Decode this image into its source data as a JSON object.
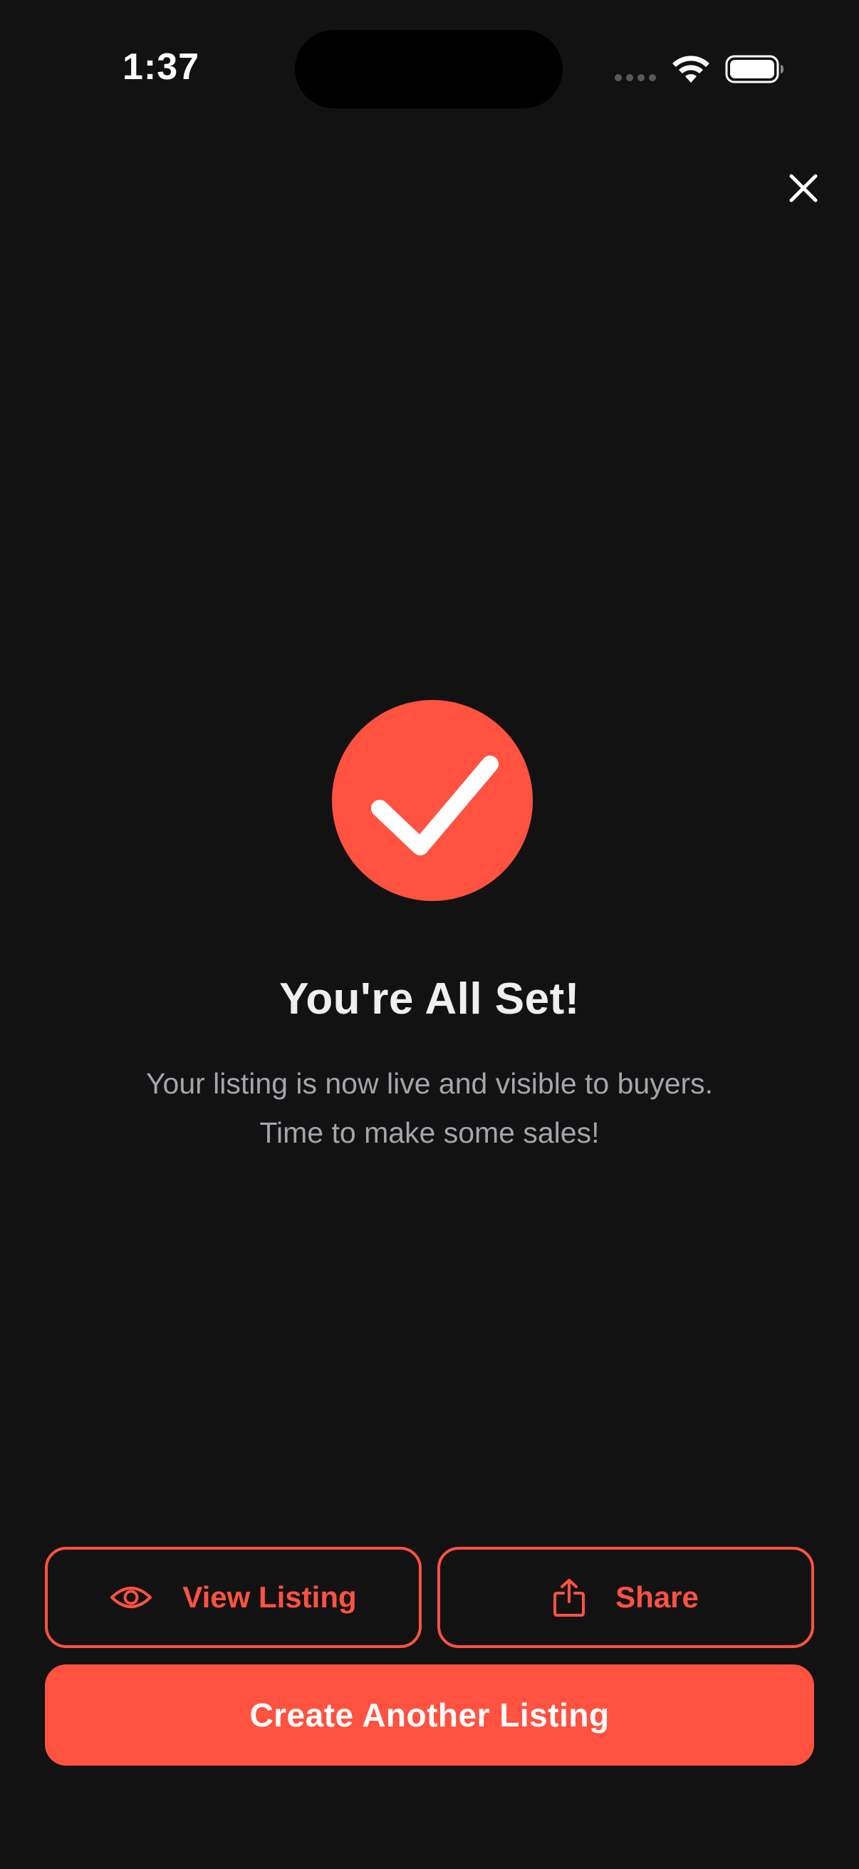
{
  "status_bar": {
    "time": "1:37",
    "icons": [
      "signal-icon",
      "wifi-icon",
      "battery-icon"
    ]
  },
  "header": {
    "close_icon": "close-icon"
  },
  "success": {
    "icon": "checkmark-icon",
    "title": "You're All Set!",
    "message_line1": "Your listing is now live and visible to buyers.",
    "message_line2": "Time to make some sales!"
  },
  "actions": {
    "view_listing": {
      "label": "View Listing",
      "icon": "eye-icon"
    },
    "share": {
      "label": "Share",
      "icon": "share-icon"
    },
    "create_another": {
      "label": "Create Another Listing"
    }
  },
  "colors": {
    "background": "#121212",
    "accent": "#ff5240",
    "title_text": "#efefef",
    "body_text": "#a5a5ad"
  }
}
